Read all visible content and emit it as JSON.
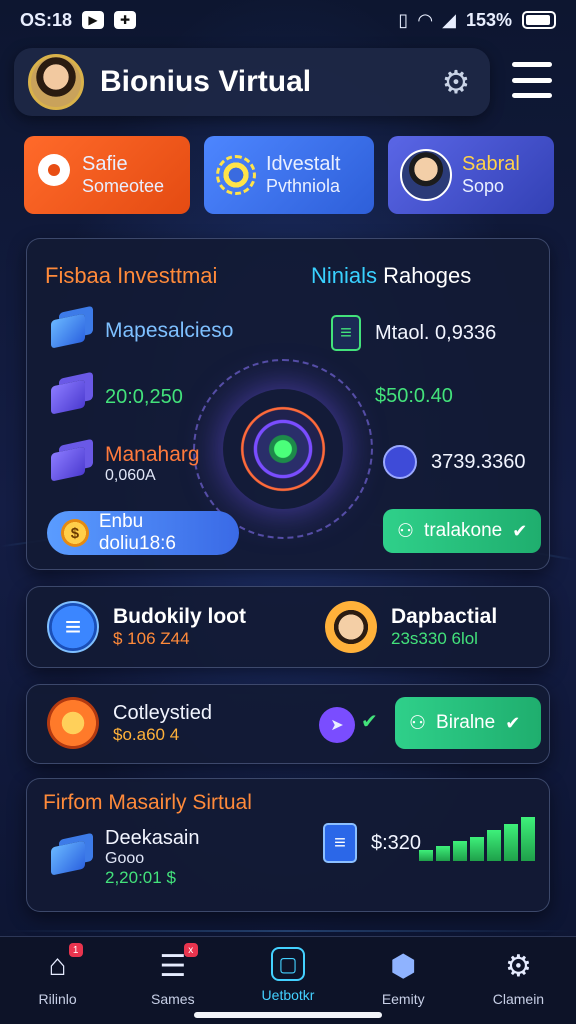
{
  "status_bar": {
    "time": "OS:18",
    "battery": "153%"
  },
  "header": {
    "title": "Bionius Virtual"
  },
  "quick_actions": [
    {
      "title": "Safie",
      "subtitle": "Someotee"
    },
    {
      "title": "Idvestalt",
      "subtitle": "Pvthniola"
    },
    {
      "title": "Sabral",
      "subtitle": "Sopo"
    }
  ],
  "investment_panel": {
    "title_left": "Fisbaa Investtmai",
    "title_right_prefix": "Ninials",
    "title_right_suffix": " Rahoges",
    "items_left": [
      {
        "label": "Mapesalcieso"
      },
      {
        "label": "20:0,250"
      },
      {
        "label": "Manaharg",
        "sub": "0,060A"
      }
    ],
    "items_right": [
      {
        "label": "Mtaol. 0,9336"
      },
      {
        "label": "$50:0.40"
      },
      {
        "label": "3739.3360"
      }
    ],
    "pill_left": {
      "coin": "$",
      "label": "Enbu doliu18:6"
    },
    "pill_right": {
      "label": "tralakone"
    }
  },
  "wallet_panel": {
    "left": {
      "title": "Budokily loot",
      "value": "$ 106 Z44"
    },
    "right": {
      "title": "Dapbactial",
      "value": "23s330 6lol"
    }
  },
  "cert_panel": {
    "title": "Cotleystied",
    "value": "$o.a60 4",
    "button": "Biralne"
  },
  "summary_panel": {
    "title": "Firfom Masairly Sirtual",
    "item_title": "Deekasain",
    "item_sub": "Gooo",
    "item_value": "2,20:01 $",
    "amount": "$:320",
    "bars": [
      0.25,
      0.35,
      0.45,
      0.55,
      0.7,
      0.85,
      1.0
    ]
  },
  "bottom_nav": [
    {
      "label": "Rilinlo",
      "icon": "home-icon",
      "badge": "1"
    },
    {
      "label": "Sames",
      "icon": "list-icon",
      "badge": "x"
    },
    {
      "label": "Uetbotkr",
      "icon": "square-icon",
      "active": true
    },
    {
      "label": "Eemity",
      "icon": "location-icon"
    },
    {
      "label": "Clamein",
      "icon": "gear-icon"
    }
  ],
  "colors": {
    "orange": "#e44b12",
    "blue": "#2e5fd9",
    "green": "#1fae6e",
    "accent": "#44d1ff"
  }
}
